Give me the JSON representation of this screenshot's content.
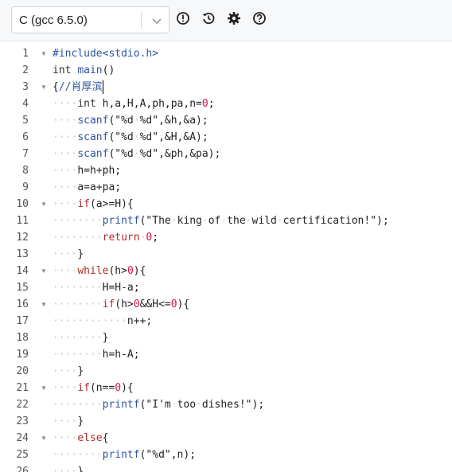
{
  "toolbar": {
    "language": "C (gcc 6.5.0)",
    "icons": [
      "info-icon",
      "history-icon",
      "gear-icon",
      "help-icon"
    ]
  },
  "editor": {
    "lines": [
      {
        "n": "1",
        "fold": true,
        "tokens": [
          [
            "pp",
            "#include<stdio.h>"
          ]
        ]
      },
      {
        "n": "2",
        "fold": false,
        "tokens": [
          [
            "typ",
            "int "
          ],
          [
            "fn",
            "main"
          ],
          [
            "",
            "()"
          ]
        ]
      },
      {
        "n": "3",
        "fold": true,
        "tokens": [
          [
            "",
            "{"
          ],
          [
            "cmt",
            "//肖厚滨"
          ]
        ],
        "cursor": true
      },
      {
        "n": "4",
        "fold": false,
        "tokens": [
          [
            "ws",
            "····"
          ],
          [
            "typ",
            "int "
          ],
          [
            "",
            "h,a,H,A,ph,pa,n="
          ],
          [
            "num",
            "0"
          ],
          [
            "",
            ";"
          ]
        ]
      },
      {
        "n": "5",
        "fold": false,
        "tokens": [
          [
            "ws",
            "····"
          ],
          [
            "fn",
            "scanf"
          ],
          [
            "",
            "(\"%d"
          ],
          [
            "ws",
            "·"
          ],
          [
            "",
            "%d\",&h,&a);"
          ]
        ]
      },
      {
        "n": "6",
        "fold": false,
        "tokens": [
          [
            "ws",
            "····"
          ],
          [
            "fn",
            "scanf"
          ],
          [
            "",
            "(\"%d"
          ],
          [
            "ws",
            "·"
          ],
          [
            "",
            "%d\",&H,&A);"
          ]
        ]
      },
      {
        "n": "7",
        "fold": false,
        "tokens": [
          [
            "ws",
            "····"
          ],
          [
            "fn",
            "scanf"
          ],
          [
            "",
            "(\"%d"
          ],
          [
            "ws",
            "·"
          ],
          [
            "",
            "%d\",&ph,&pa);"
          ]
        ]
      },
      {
        "n": "8",
        "fold": false,
        "tokens": [
          [
            "ws",
            "····"
          ],
          [
            "",
            "h=h+ph;"
          ]
        ]
      },
      {
        "n": "9",
        "fold": false,
        "tokens": [
          [
            "ws",
            "····"
          ],
          [
            "",
            "a=a+pa;"
          ]
        ]
      },
      {
        "n": "10",
        "fold": true,
        "tokens": [
          [
            "ws",
            "····"
          ],
          [
            "kw",
            "if"
          ],
          [
            "",
            "(a>=H){"
          ]
        ]
      },
      {
        "n": "11",
        "fold": false,
        "tokens": [
          [
            "ws",
            "········"
          ],
          [
            "fn",
            "printf"
          ],
          [
            "",
            "(\"The"
          ],
          [
            "ws",
            "·"
          ],
          [
            "",
            "king"
          ],
          [
            "ws",
            "·"
          ],
          [
            "",
            "of"
          ],
          [
            "ws",
            "·"
          ],
          [
            "",
            "the"
          ],
          [
            "ws",
            "·"
          ],
          [
            "",
            "wild"
          ],
          [
            "ws",
            "·"
          ],
          [
            "",
            "certification!\");"
          ]
        ]
      },
      {
        "n": "12",
        "fold": false,
        "tokens": [
          [
            "ws",
            "········"
          ],
          [
            "kw",
            "return"
          ],
          [
            "ws",
            "·"
          ],
          [
            "num",
            "0"
          ],
          [
            "",
            ";"
          ]
        ]
      },
      {
        "n": "13",
        "fold": false,
        "tokens": [
          [
            "ws",
            "····"
          ],
          [
            "",
            "}"
          ]
        ]
      },
      {
        "n": "14",
        "fold": true,
        "tokens": [
          [
            "ws",
            "····"
          ],
          [
            "kw",
            "while"
          ],
          [
            "",
            "(h>"
          ],
          [
            "num",
            "0"
          ],
          [
            "",
            "){"
          ]
        ]
      },
      {
        "n": "15",
        "fold": false,
        "tokens": [
          [
            "ws",
            "········"
          ],
          [
            "",
            "H=H-a;"
          ]
        ]
      },
      {
        "n": "16",
        "fold": true,
        "tokens": [
          [
            "ws",
            "········"
          ],
          [
            "kw",
            "if"
          ],
          [
            "",
            "(h>"
          ],
          [
            "num",
            "0"
          ],
          [
            "",
            "&&H<="
          ],
          [
            "num",
            "0"
          ],
          [
            "",
            "){"
          ]
        ]
      },
      {
        "n": "17",
        "fold": false,
        "tokens": [
          [
            "ws",
            "············"
          ],
          [
            "",
            "n++;"
          ]
        ]
      },
      {
        "n": "18",
        "fold": false,
        "tokens": [
          [
            "ws",
            "········"
          ],
          [
            "",
            "}"
          ]
        ]
      },
      {
        "n": "19",
        "fold": false,
        "tokens": [
          [
            "ws",
            "········"
          ],
          [
            "",
            "h=h-A;"
          ]
        ]
      },
      {
        "n": "20",
        "fold": false,
        "tokens": [
          [
            "ws",
            "····"
          ],
          [
            "",
            "}"
          ]
        ]
      },
      {
        "n": "21",
        "fold": true,
        "tokens": [
          [
            "ws",
            "····"
          ],
          [
            "kw",
            "if"
          ],
          [
            "",
            "(n=="
          ],
          [
            "num",
            "0"
          ],
          [
            "",
            "){"
          ]
        ]
      },
      {
        "n": "22",
        "fold": false,
        "tokens": [
          [
            "ws",
            "········"
          ],
          [
            "fn",
            "printf"
          ],
          [
            "",
            "(\"I'm"
          ],
          [
            "ws",
            "·"
          ],
          [
            "",
            "too"
          ],
          [
            "ws",
            "·"
          ],
          [
            "",
            "dishes!\");"
          ]
        ]
      },
      {
        "n": "23",
        "fold": false,
        "tokens": [
          [
            "ws",
            "····"
          ],
          [
            "",
            "}"
          ]
        ]
      },
      {
        "n": "24",
        "fold": true,
        "tokens": [
          [
            "ws",
            "····"
          ],
          [
            "kw",
            "else"
          ],
          [
            "",
            "{"
          ]
        ]
      },
      {
        "n": "25",
        "fold": false,
        "tokens": [
          [
            "ws",
            "········"
          ],
          [
            "fn",
            "printf"
          ],
          [
            "",
            "(\"%d\",n);"
          ]
        ]
      },
      {
        "n": "26",
        "fold": false,
        "tokens": [
          [
            "ws",
            "····"
          ],
          [
            "",
            "}"
          ]
        ]
      }
    ]
  }
}
